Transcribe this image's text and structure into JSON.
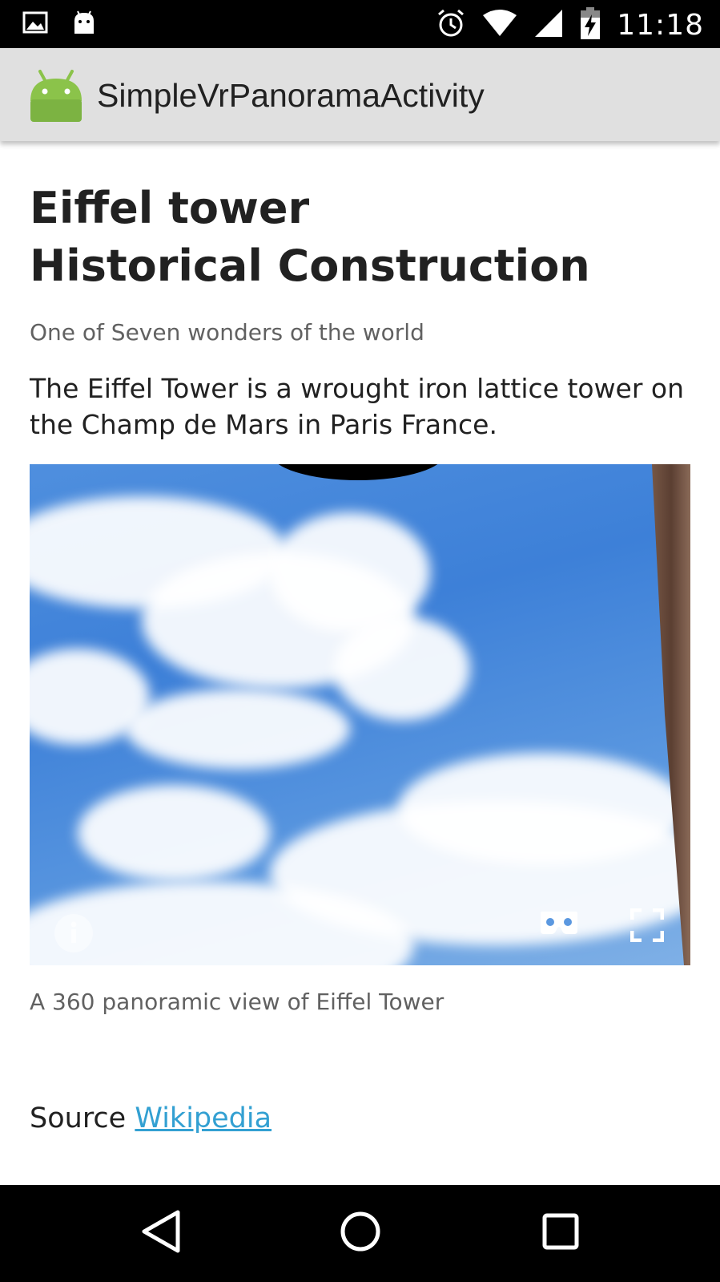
{
  "status_bar": {
    "time": "11:18",
    "left_icons": [
      "image-notification-icon",
      "android-notification-icon"
    ],
    "right_icons": [
      "alarm-icon",
      "wifi-icon",
      "cellular-signal-icon",
      "battery-charging-icon"
    ]
  },
  "app_bar": {
    "title": "SimpleVrPanoramaActivity",
    "icon": "android-launcher-icon"
  },
  "article": {
    "title_line1": "Eiffel tower",
    "title_line2": "Historical Construction",
    "subtitle": "One of Seven wonders of the world",
    "body": "The Eiffel Tower is a wrought iron lattice tower on the Champ de Mars in Paris France.",
    "caption": "A 360 panoramic view of Eiffel Tower",
    "source_label": "Source",
    "source_link": "Wikipedia"
  },
  "panorama": {
    "controls": [
      "info-icon",
      "cardboard-vr-icon",
      "fullscreen-icon"
    ]
  },
  "nav_bar": {
    "buttons": [
      "back-icon",
      "home-icon",
      "recents-icon"
    ]
  },
  "colors": {
    "link": "#33a0d2",
    "app_bar": "#e0e0e0",
    "android_green": "#8bc34a"
  }
}
